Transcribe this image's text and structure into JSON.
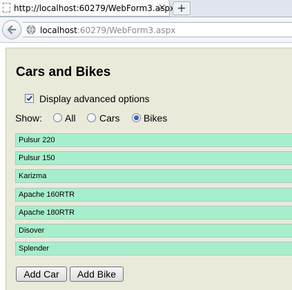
{
  "browser": {
    "tab_title": "http://localhost:60279/WebForm3.aspx",
    "tab_close": "×",
    "new_tab": "+",
    "url_host": "localhost",
    "url_path": ":60279/WebForm3.aspx"
  },
  "page": {
    "title": "Cars and Bikes",
    "advanced_options": {
      "label": "Display advanced options",
      "checked": true
    },
    "show": {
      "label": "Show:",
      "options": [
        {
          "label": "All",
          "selected": false
        },
        {
          "label": "Cars",
          "selected": false
        },
        {
          "label": "Bikes",
          "selected": true
        }
      ]
    },
    "items": [
      "Pulsur 220",
      "Pulsur 150",
      "Karizma",
      "Apache 160RTR",
      "Apache 180RTR",
      "Disover",
      "Splender"
    ],
    "buttons": {
      "add_car": "Add Car",
      "add_bike": "Add Bike"
    }
  }
}
